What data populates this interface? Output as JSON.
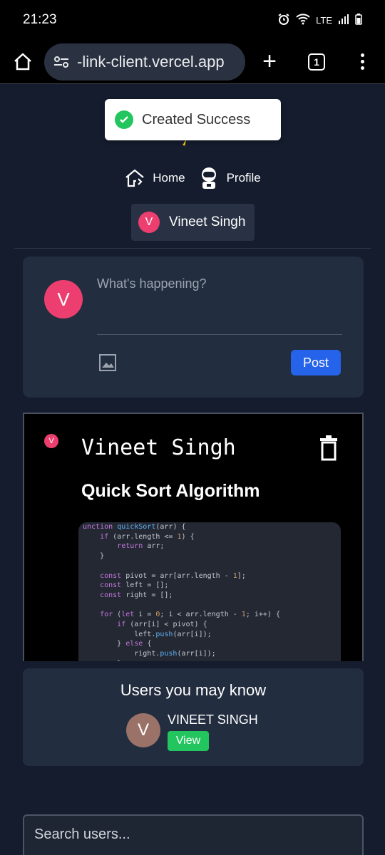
{
  "status_bar": {
    "time": "21:23",
    "network": "LTE"
  },
  "browser": {
    "url": "-link-client.vercel.app",
    "tab_count": "1"
  },
  "toast": {
    "message": "Created Success"
  },
  "nav": {
    "home_label": "Home",
    "profile_label": "Profile"
  },
  "current_user": {
    "initial": "V",
    "name": "Vineet Singh"
  },
  "composer": {
    "avatar_initial": "V",
    "placeholder": "What's happening?",
    "post_label": "Post"
  },
  "post": {
    "avatar_initial": "V",
    "author": "Vineet Singh",
    "title": "Quick Sort Algorithm"
  },
  "suggestions": {
    "heading": "Users you may know",
    "users": [
      {
        "initial": "V",
        "name": "VINEET SINGH",
        "action": "View"
      }
    ]
  },
  "search": {
    "placeholder": "Search users..."
  },
  "colors": {
    "background": "#141c2e",
    "card": "#222d3f",
    "accent_blue": "#2563eb",
    "accent_green": "#22c55e",
    "avatar_pink": "#ec3f6f"
  }
}
